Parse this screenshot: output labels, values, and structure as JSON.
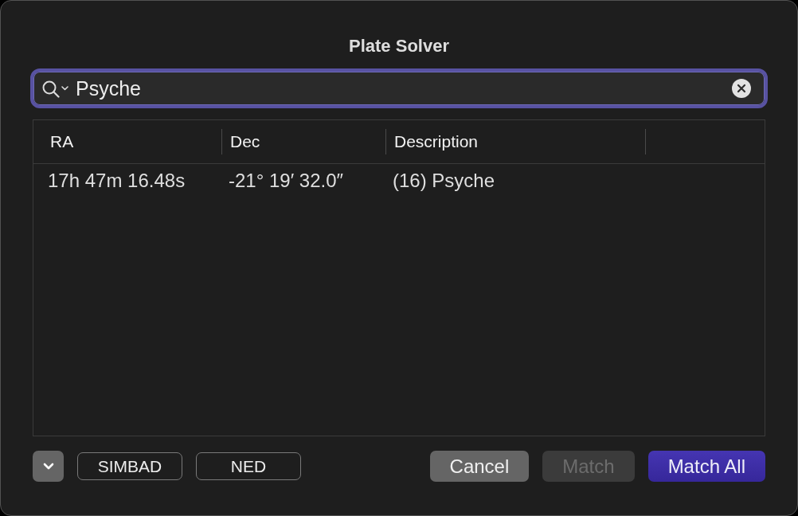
{
  "window": {
    "title": "Plate Solver"
  },
  "search": {
    "value": "Psyche",
    "focused": true
  },
  "table": {
    "columns": [
      "RA",
      "Dec",
      "Description"
    ],
    "rows": [
      {
        "cells": [
          "17h 47m 16.48s",
          "-21° 19′ 32.0″",
          "(16) Psyche"
        ],
        "selected": false
      }
    ]
  },
  "options_toggle": {
    "expanded": false
  },
  "catalog_buttons": [
    {
      "label": "SIMBAD"
    },
    {
      "label": "NED"
    }
  ],
  "buttons": [
    {
      "label": "Cancel",
      "kind": "normal",
      "disabled": false
    },
    {
      "label": "Match",
      "kind": "normal",
      "disabled": true
    },
    {
      "label": "Match All",
      "kind": "default",
      "disabled": false
    }
  ]
}
